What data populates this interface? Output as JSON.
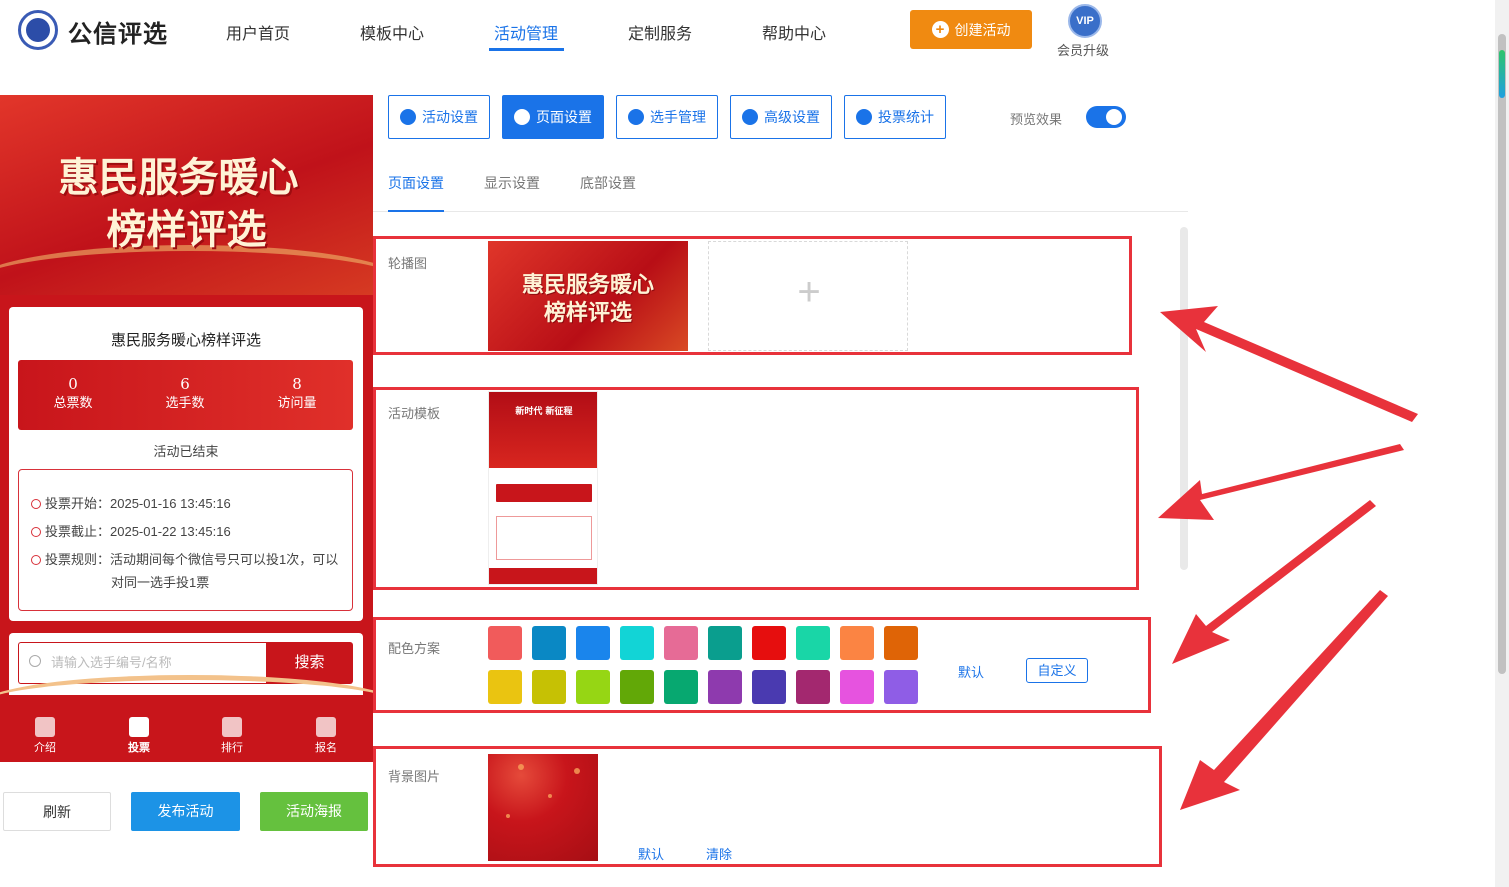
{
  "header": {
    "brand": "公信评选",
    "nav": [
      "用户首页",
      "模板中心",
      "活动管理",
      "定制服务",
      "帮助中心"
    ],
    "active_nav": "活动管理",
    "create_button": "创建活动",
    "vip_badge": "VIP",
    "vip_label": "会员升级"
  },
  "preview": {
    "banner_line1": "惠民服务暖心",
    "banner_line2": "榜样评选",
    "activity_title": "惠民服务暖心榜样评选",
    "stats": [
      {
        "value": "0",
        "label": "总票数"
      },
      {
        "value": "6",
        "label": "选手数"
      },
      {
        "value": "8",
        "label": "访问量"
      }
    ],
    "status": "活动已结束",
    "rules": {
      "start": "投票开始：2025-01-16 13:45:16",
      "end": "投票截止：2025-01-22 13:45:16",
      "rule_line1": "投票规则：活动期间每个微信号只可以投1次，可以",
      "rule_line2": "对同一选手投1票"
    },
    "search_placeholder": "请输入选手编号/名称",
    "search_button": "搜索",
    "tabs": [
      {
        "label": "介绍",
        "icon": "book-icon"
      },
      {
        "label": "投票",
        "icon": "home-icon"
      },
      {
        "label": "排行",
        "icon": "rank-icon"
      },
      {
        "label": "报名",
        "icon": "signup-icon"
      }
    ],
    "active_tab": "投票"
  },
  "actions": {
    "refresh": "刷新",
    "publish": "发布活动",
    "poster": "活动海报"
  },
  "toolbar": {
    "buttons": [
      {
        "label": "活动设置",
        "icon": "star-icon"
      },
      {
        "label": "页面设置",
        "icon": "gear-icon"
      },
      {
        "label": "选手管理",
        "icon": "users-icon"
      },
      {
        "label": "高级设置",
        "icon": "settings-icon"
      },
      {
        "label": "投票统计",
        "icon": "chart-icon"
      }
    ],
    "active": "页面设置",
    "preview_label": "预览效果",
    "preview_enabled": true
  },
  "subtabs": [
    "页面设置",
    "显示设置",
    "底部设置"
  ],
  "active_subtab": "页面设置",
  "sections": {
    "carousel": {
      "label": "轮播图",
      "image_line1": "惠民服务暖心",
      "image_line2": "榜样评选"
    },
    "template": {
      "label": "活动模板",
      "thumb_title": "新时代 新征程"
    },
    "colors": {
      "label": "配色方案",
      "swatches": [
        "#f15b5b",
        "#0a88c4",
        "#1a85ec",
        "#12d4d6",
        "#e66b96",
        "#0a9e8e",
        "#e60e0e",
        "#19d6a7",
        "#fb8443",
        "#df6406",
        "#eac411",
        "#c6c104",
        "#96d614",
        "#62a807",
        "#07a870",
        "#8e3aae",
        "#4a3ab0",
        "#a3286f",
        "#e653df",
        "#8f5de6"
      ],
      "default_link": "默认",
      "custom_button": "自定义"
    },
    "background": {
      "label": "背景图片",
      "default_link": "默认",
      "clear_link": "清除"
    }
  },
  "accent_color": "#1a73e8",
  "highlight_color": "#e8323b"
}
